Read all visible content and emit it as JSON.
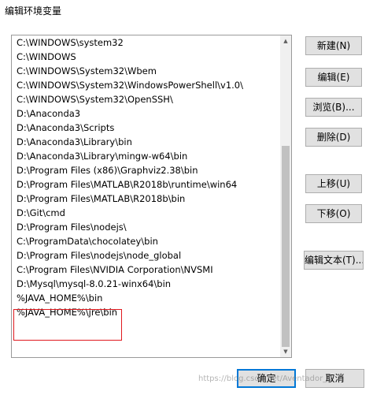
{
  "window": {
    "title": "编辑环境变量"
  },
  "path_list": {
    "items": [
      "C:\\WINDOWS\\system32",
      "C:\\WINDOWS",
      "C:\\WINDOWS\\System32\\Wbem",
      "C:\\WINDOWS\\System32\\WindowsPowerShell\\v1.0\\",
      "C:\\WINDOWS\\System32\\OpenSSH\\",
      "D:\\Anaconda3",
      "D:\\Anaconda3\\Scripts",
      "D:\\Anaconda3\\Library\\bin",
      "D:\\Anaconda3\\Library\\mingw-w64\\bin",
      "D:\\Program Files (x86)\\Graphviz2.38\\bin",
      "D:\\Program Files\\MATLAB\\R2018b\\runtime\\win64",
      "D:\\Program Files\\MATLAB\\R2018b\\bin",
      "D:\\Git\\cmd",
      "D:\\Program Files\\nodejs\\",
      "C:\\ProgramData\\chocolatey\\bin",
      "D:\\Program Files\\nodejs\\node_global",
      "C:\\Program Files\\NVIDIA Corporation\\NVSMI",
      "D:\\Mysql\\mysql-8.0.21-winx64\\bin",
      "%JAVA_HOME%\\bin",
      "%JAVA_HOME%\\jre\\bin"
    ]
  },
  "buttons": {
    "new": "新建(N)",
    "edit": "编辑(E)",
    "browse": "浏览(B)...",
    "delete": "删除(D)",
    "move_up": "上移(U)",
    "move_down": "下移(O)",
    "edit_text": "编辑文本(T)...",
    "ok": "确定",
    "cancel": "取消"
  },
  "watermark": "https://blog.csdn.net/Aventador_S"
}
